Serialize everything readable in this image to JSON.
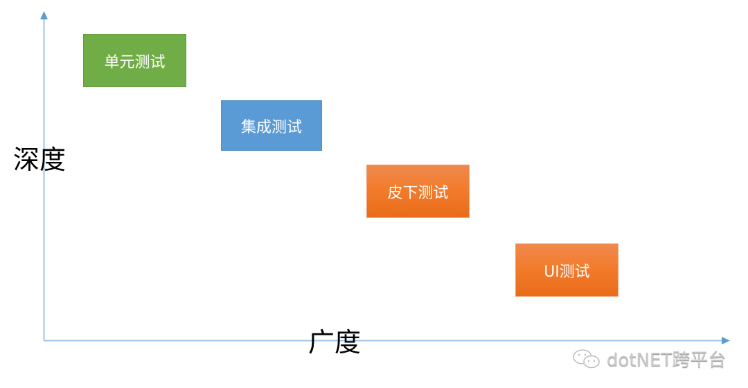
{
  "diagram": {
    "y_axis_label": "深度",
    "x_axis_label": "广度",
    "boxes": [
      {
        "label": "单元测试",
        "color": "#70ad47"
      },
      {
        "label": "集成测试",
        "color": "#5b9bd5"
      },
      {
        "label": "皮下测试",
        "color": "#f27c2c"
      },
      {
        "label": "UI测试",
        "color": "#f27c2c"
      }
    ],
    "axis_color": "#5b9bd5"
  },
  "watermark": {
    "icon": "wechat-icon",
    "text": "dotNET跨平台"
  }
}
